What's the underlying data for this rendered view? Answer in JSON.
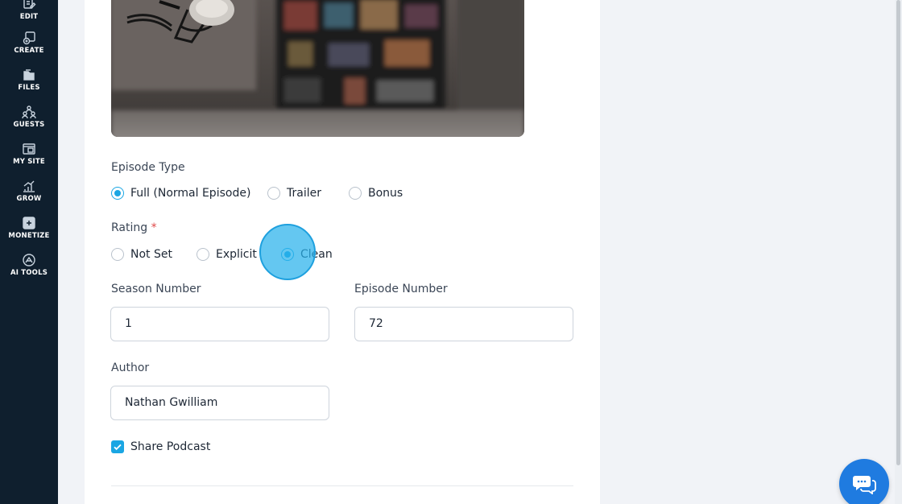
{
  "sidebar": {
    "items": [
      {
        "label": "EDIT",
        "icon": "edit-icon"
      },
      {
        "label": "CREATE",
        "icon": "create-icon"
      },
      {
        "label": "FILES",
        "icon": "files-icon"
      },
      {
        "label": "GUESTS",
        "icon": "guests-icon"
      },
      {
        "label": "MY SITE",
        "icon": "my-site-icon"
      },
      {
        "label": "GROW",
        "icon": "grow-icon"
      },
      {
        "label": "MONETIZE",
        "icon": "monetize-icon"
      },
      {
        "label": "AI TOOLS",
        "icon": "ai-tools-icon"
      }
    ]
  },
  "form": {
    "episode_type": {
      "label": "Episode Type",
      "options": [
        "Full (Normal Episode)",
        "Trailer",
        "Bonus"
      ],
      "selected": "Full (Normal Episode)"
    },
    "rating": {
      "label": "Rating",
      "required_mark": "*",
      "options": [
        "Not Set",
        "Explicit",
        "Clean"
      ],
      "selected": "Clean"
    },
    "season_number": {
      "label": "Season Number",
      "value": "1"
    },
    "episode_number": {
      "label": "Episode Number",
      "value": "72"
    },
    "author": {
      "label": "Author",
      "value": "Nathan Gwilliam"
    },
    "share_podcast": {
      "label": "Share Podcast",
      "checked": true
    }
  },
  "colors": {
    "sidebar_bg": "#0f1f2e",
    "accent": "#1aa6e3",
    "chat_button": "#1f7be0",
    "page_bg": "#f1f3f7"
  }
}
